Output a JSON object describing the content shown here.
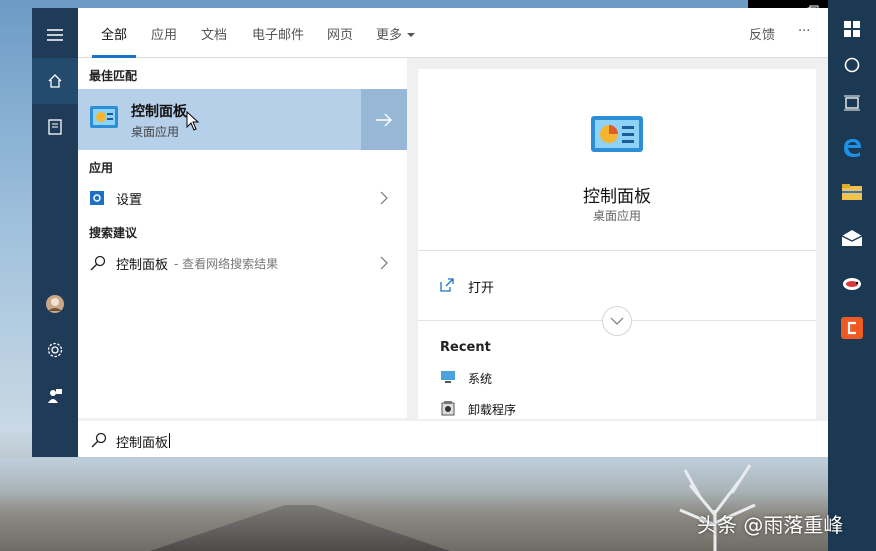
{
  "tabs": {
    "all": "全部",
    "apps": "应用",
    "docs": "文档",
    "email": "电子邮件",
    "web": "网页",
    "more": "更多",
    "feedback": "反馈",
    "options": "···"
  },
  "best_match": {
    "header": "最佳匹配",
    "title": "控制面板",
    "subtitle": "桌面应用"
  },
  "apps_section": {
    "header": "应用",
    "items": [
      {
        "label": "设置"
      }
    ]
  },
  "suggestions": {
    "header": "搜索建议",
    "items": [
      {
        "label": "控制面板",
        "hint": " - 查看网络搜索结果"
      }
    ]
  },
  "detail": {
    "title": "控制面板",
    "subtitle": "桌面应用",
    "open_label": "打开",
    "recent_header": "Recent",
    "recent_items": [
      {
        "label": "系统"
      },
      {
        "label": "卸载程序"
      }
    ]
  },
  "search": {
    "query": "控制面板"
  },
  "watermark": "头条 @雨落重峰",
  "colors": {
    "accent": "#1a73c9",
    "selected_bg": "#b7d0ea",
    "rail_bg": "#1f3b58",
    "taskbar_bg": "#1c3953"
  }
}
